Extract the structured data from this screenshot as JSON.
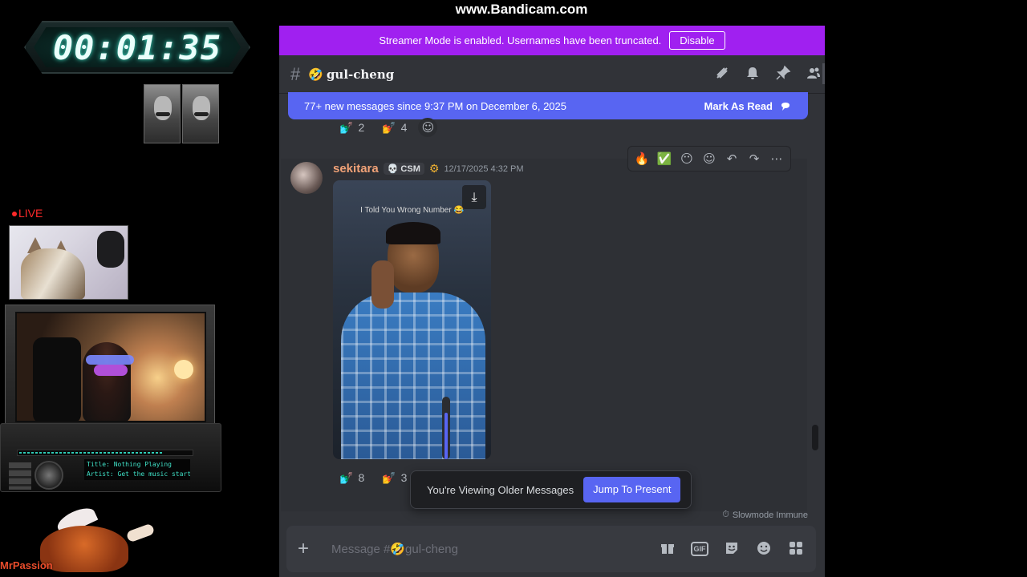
{
  "watermark": "www.Bandicam.com",
  "overlay": {
    "timer": "00:01:35",
    "live_label": "LIVE",
    "radio": {
      "title_line": "Title: Nothing Playing",
      "artist_line": "Artist: Get the music started"
    },
    "streamer_name": "MrPassion"
  },
  "discord": {
    "streamer_banner": {
      "text": "Streamer Mode is enabled. Usernames have been truncated.",
      "button": "Disable"
    },
    "channel": {
      "emoji": "🤣",
      "name": "gul-cheng"
    },
    "new_messages_bar": {
      "text": "77+ new messages since 9:37 PM on December 6, 2025",
      "action": "Mark As Read"
    },
    "prev_reactions": [
      {
        "emoji": "💅",
        "count": "2"
      },
      {
        "emoji": "💅",
        "count": "4"
      }
    ],
    "message": {
      "username": "sekitara",
      "tag": "CSM",
      "timestamp": "12/17/2025 4:32 PM",
      "video_caption": "I Told You Wrong Number 😂",
      "reactions": [
        {
          "emoji": "💅",
          "count": "8"
        },
        {
          "emoji": "💅",
          "count": "3"
        }
      ]
    },
    "quick_reactions": [
      "🔥",
      "✅",
      "😶"
    ],
    "older_banner": {
      "text": "You're Viewing Older Messages",
      "button": "Jump To Present"
    },
    "slowmode": "Slowmode Immune",
    "composer": {
      "placeholder": "Message #🤣gul-cheng",
      "gif_label": "GIF"
    }
  }
}
